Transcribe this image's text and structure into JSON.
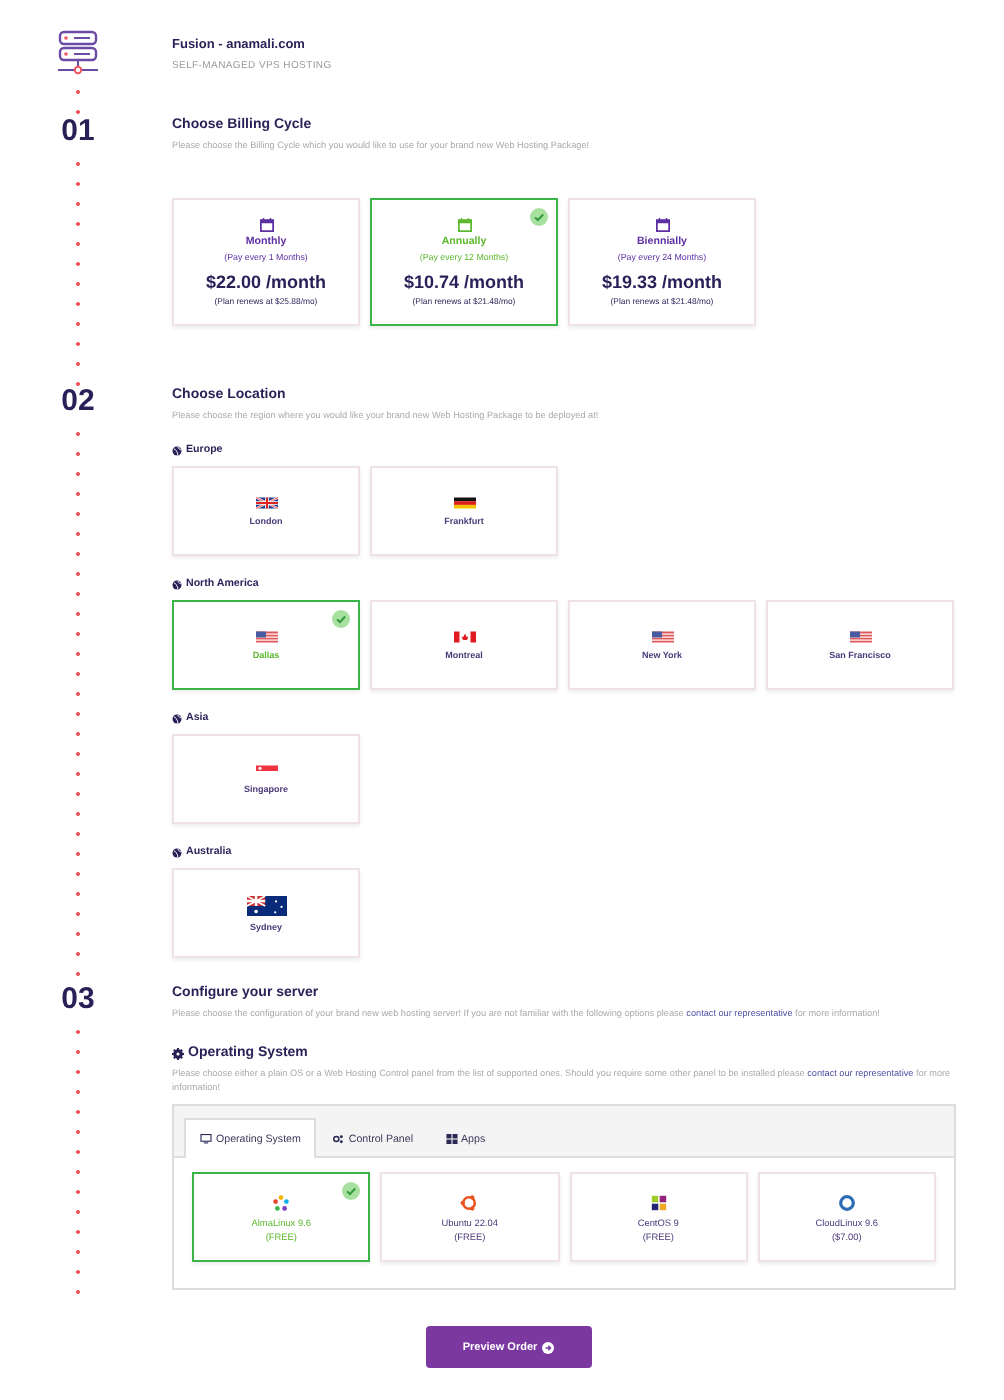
{
  "product": {
    "title": "Fusion - anamali.com",
    "subtitle": "SELF-MANAGED VPS HOSTING"
  },
  "billing": {
    "step": "01",
    "title": "Choose Billing Cycle",
    "description": "Please choose the Billing Cycle which you would like to use for your brand new Web Hosting Package!",
    "options": [
      {
        "name": "Monthly",
        "period": "(Pay every 1 Months)",
        "price": "$22.00 /month",
        "renewal": "(Plan renews at $25.88/mo)",
        "selected": false
      },
      {
        "name": "Annually",
        "period": "(Pay every 12 Months)",
        "price": "$10.74 /month",
        "renewal": "(Plan renews at $21.48/mo)",
        "selected": true
      },
      {
        "name": "Biennially",
        "period": "(Pay every 24 Months)",
        "price": "$19.33 /month",
        "renewal": "(Plan renews at $21.48/mo)",
        "selected": false
      }
    ]
  },
  "location": {
    "step": "02",
    "title": "Choose Location",
    "description": "Please choose the region where you would like your brand new Web Hosting Package to be deployed at!",
    "regions": [
      {
        "name": "Europe",
        "locations": [
          {
            "city": "London",
            "kind": "gb",
            "selected": false
          },
          {
            "city": "Frankfurt",
            "kind": "de",
            "selected": false
          }
        ]
      },
      {
        "name": "North America",
        "locations": [
          {
            "city": "Dallas",
            "kind": "us",
            "selected": true
          },
          {
            "city": "Montreal",
            "kind": "ca",
            "selected": false
          },
          {
            "city": "New York",
            "kind": "us",
            "selected": false
          },
          {
            "city": "San Francisco",
            "kind": "us",
            "selected": false
          }
        ]
      },
      {
        "name": "Asia",
        "locations": [
          {
            "city": "Singapore",
            "kind": "sg",
            "selected": false
          }
        ]
      },
      {
        "name": "Australia",
        "locations": [
          {
            "city": "Sydney",
            "kind": "au",
            "selected": false
          }
        ]
      }
    ]
  },
  "configure": {
    "step": "03",
    "title": "Configure your server",
    "description": {
      "text": "Please choose the configuration of your brand new web hosting server! If you are not familiar with the following options please ",
      "link": "contact our representative",
      "text_after": " for more information!"
    },
    "os_section": {
      "title": "Operating System",
      "description": {
        "text": "Please choose either a plain OS or a Web Hosting Control panel from the list of supported ones. Should you require some other panel to be installed please ",
        "link": "contact our representative",
        "text_after": " for more information!"
      },
      "tabs": [
        {
          "label": "Operating System",
          "selected": true
        },
        {
          "label": "Control Panel",
          "selected": false
        },
        {
          "label": "Apps",
          "selected": false
        }
      ],
      "options": [
        {
          "name": "AlmaLinux 9.6",
          "price": "(FREE)",
          "kind": "alma",
          "selected": true
        },
        {
          "name": "Ubuntu 22.04",
          "price": "(FREE)",
          "kind": "ubuntu",
          "selected": false
        },
        {
          "name": "CentOS 9",
          "price": "(FREE)",
          "kind": "centos",
          "selected": false
        },
        {
          "name": "CloudLinux 9.6",
          "price": "($7.00)",
          "kind": "cloudlinux",
          "selected": false
        }
      ]
    }
  },
  "preview_button": {
    "label": "Preview Order"
  }
}
